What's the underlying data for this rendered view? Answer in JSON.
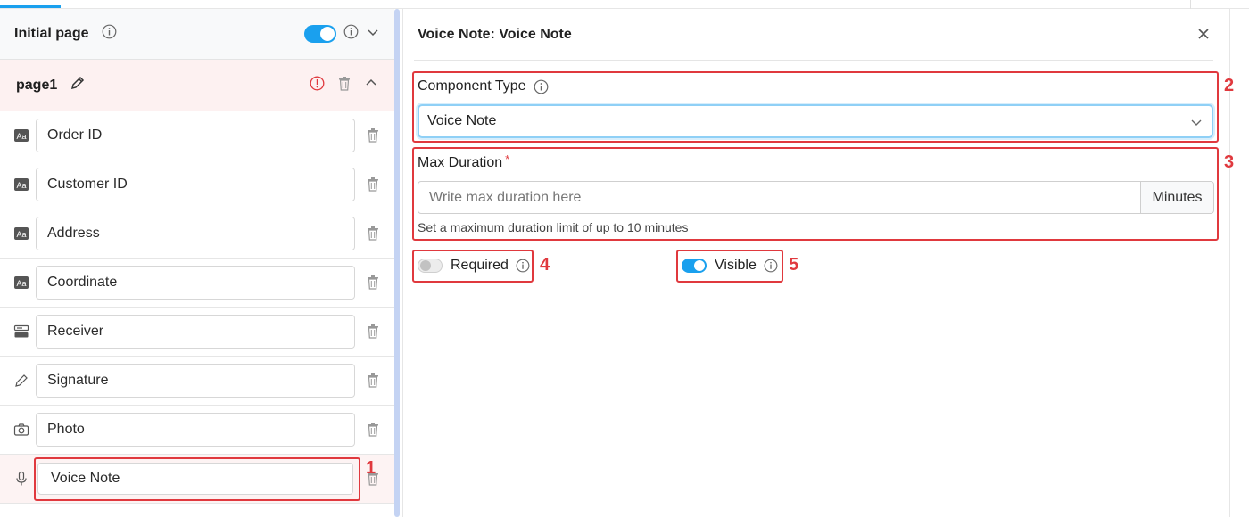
{
  "left": {
    "initial_page": {
      "title": "Initial page",
      "toggle_on": true
    },
    "page": {
      "title": "page1"
    },
    "fields": [
      {
        "label": "Order ID",
        "icon": "text-type-icon"
      },
      {
        "label": "Customer ID",
        "icon": "text-type-icon"
      },
      {
        "label": "Address",
        "icon": "text-type-icon"
      },
      {
        "label": "Coordinate",
        "icon": "text-type-icon"
      },
      {
        "label": "Receiver",
        "icon": "form-field-icon"
      },
      {
        "label": "Signature",
        "icon": "pencil-icon"
      },
      {
        "label": "Photo",
        "icon": "camera-icon"
      },
      {
        "label": "Voice Note",
        "icon": "microphone-icon",
        "selected": true
      }
    ]
  },
  "right": {
    "title": "Voice Note: Voice Note",
    "component_type": {
      "label": "Component Type",
      "value": "Voice Note"
    },
    "max_duration": {
      "label": "Max Duration",
      "required_mark": "*",
      "placeholder": "Write max duration here",
      "value": "",
      "suffix": "Minutes",
      "hint": "Set a maximum duration limit of up to 10 minutes"
    },
    "required_toggle": {
      "label": "Required",
      "on": false
    },
    "visible_toggle": {
      "label": "Visible",
      "on": true
    }
  },
  "annotations": [
    "1",
    "2",
    "3",
    "4",
    "5"
  ],
  "colors": {
    "accent": "#1aa0ee",
    "highlight": "#e0393e",
    "selected_bg": "#fdf1f1"
  }
}
